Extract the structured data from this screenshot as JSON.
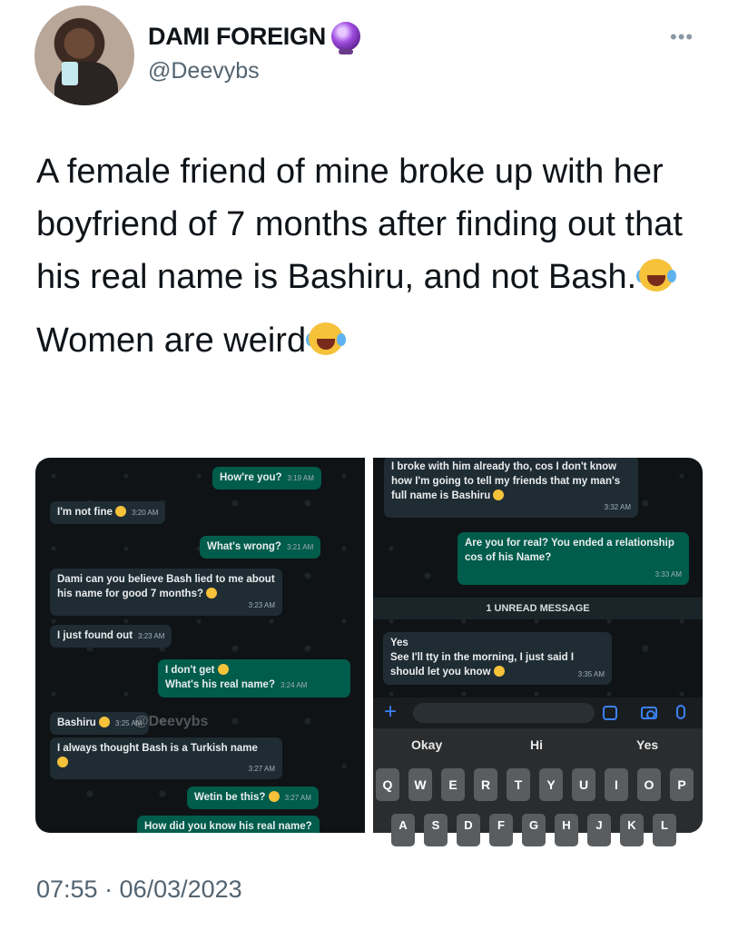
{
  "author": {
    "display_name": "DAMI FOREIGN",
    "handle": "@Deevybs",
    "badge_icon": "crystal-ball-icon"
  },
  "tweet": {
    "paragraph1": "A female friend of mine broke up with her boyfriend of 7 months after finding out that his real name is Bashiru, and not Bash.",
    "paragraph2": "Women are weird",
    "emoji": "face-with-tears-of-joy"
  },
  "screenshot_left": {
    "messages": [
      {
        "dir": "out",
        "text": "How're you?",
        "time": "3:19 AM"
      },
      {
        "dir": "in",
        "text": "I'm not fine",
        "time": "3:20 AM"
      },
      {
        "dir": "out",
        "text": "What's wrong?",
        "time": "3:21 AM"
      },
      {
        "dir": "in",
        "text": "Dami can you believe Bash lied to me about his name for good 7 months?",
        "time": "3:23 AM"
      },
      {
        "dir": "in",
        "text": "I just found out",
        "time": "3:23 AM"
      },
      {
        "dir": "out",
        "text": "I don't get",
        "text2": "What's his real name?",
        "time": "3:24 AM"
      },
      {
        "dir": "in",
        "text": "Bashiru",
        "time": "3:25 AM"
      },
      {
        "dir": "in",
        "text": "I always thought Bash is a Turkish name",
        "time": "3:27 AM"
      },
      {
        "dir": "out",
        "text": "Wetin be this?",
        "time": "3:27 AM"
      },
      {
        "dir": "out",
        "text": "How did you know his real name?",
        "time": ""
      }
    ],
    "watermark": "@Deevybs"
  },
  "screenshot_right": {
    "messages": [
      {
        "dir": "in",
        "text": "I broke with him already tho, cos I don't know how I'm going to tell my friends that my man's full name is Bashiru",
        "time": "3:32 AM"
      },
      {
        "dir": "out",
        "text": "Are you for real? You ended a relationship cos of his Name?",
        "time": "3:33 AM"
      },
      {
        "dir": "in",
        "text": "Yes",
        "text2": "See I'll tty in the morning, I just said I should let you know",
        "time": "3:35 AM"
      }
    ],
    "unread_label": "1 UNREAD MESSAGE",
    "suggestions": [
      "Okay",
      "Hi",
      "Yes"
    ],
    "keys_row1": [
      "Q",
      "W",
      "E",
      "R",
      "T",
      "Y",
      "U",
      "I",
      "O",
      "P"
    ],
    "keys_row2": [
      "A",
      "S",
      "D",
      "F",
      "G",
      "H",
      "J",
      "K",
      "L"
    ]
  },
  "footer": {
    "timestamp": "07:55 · 06/03/2023"
  }
}
